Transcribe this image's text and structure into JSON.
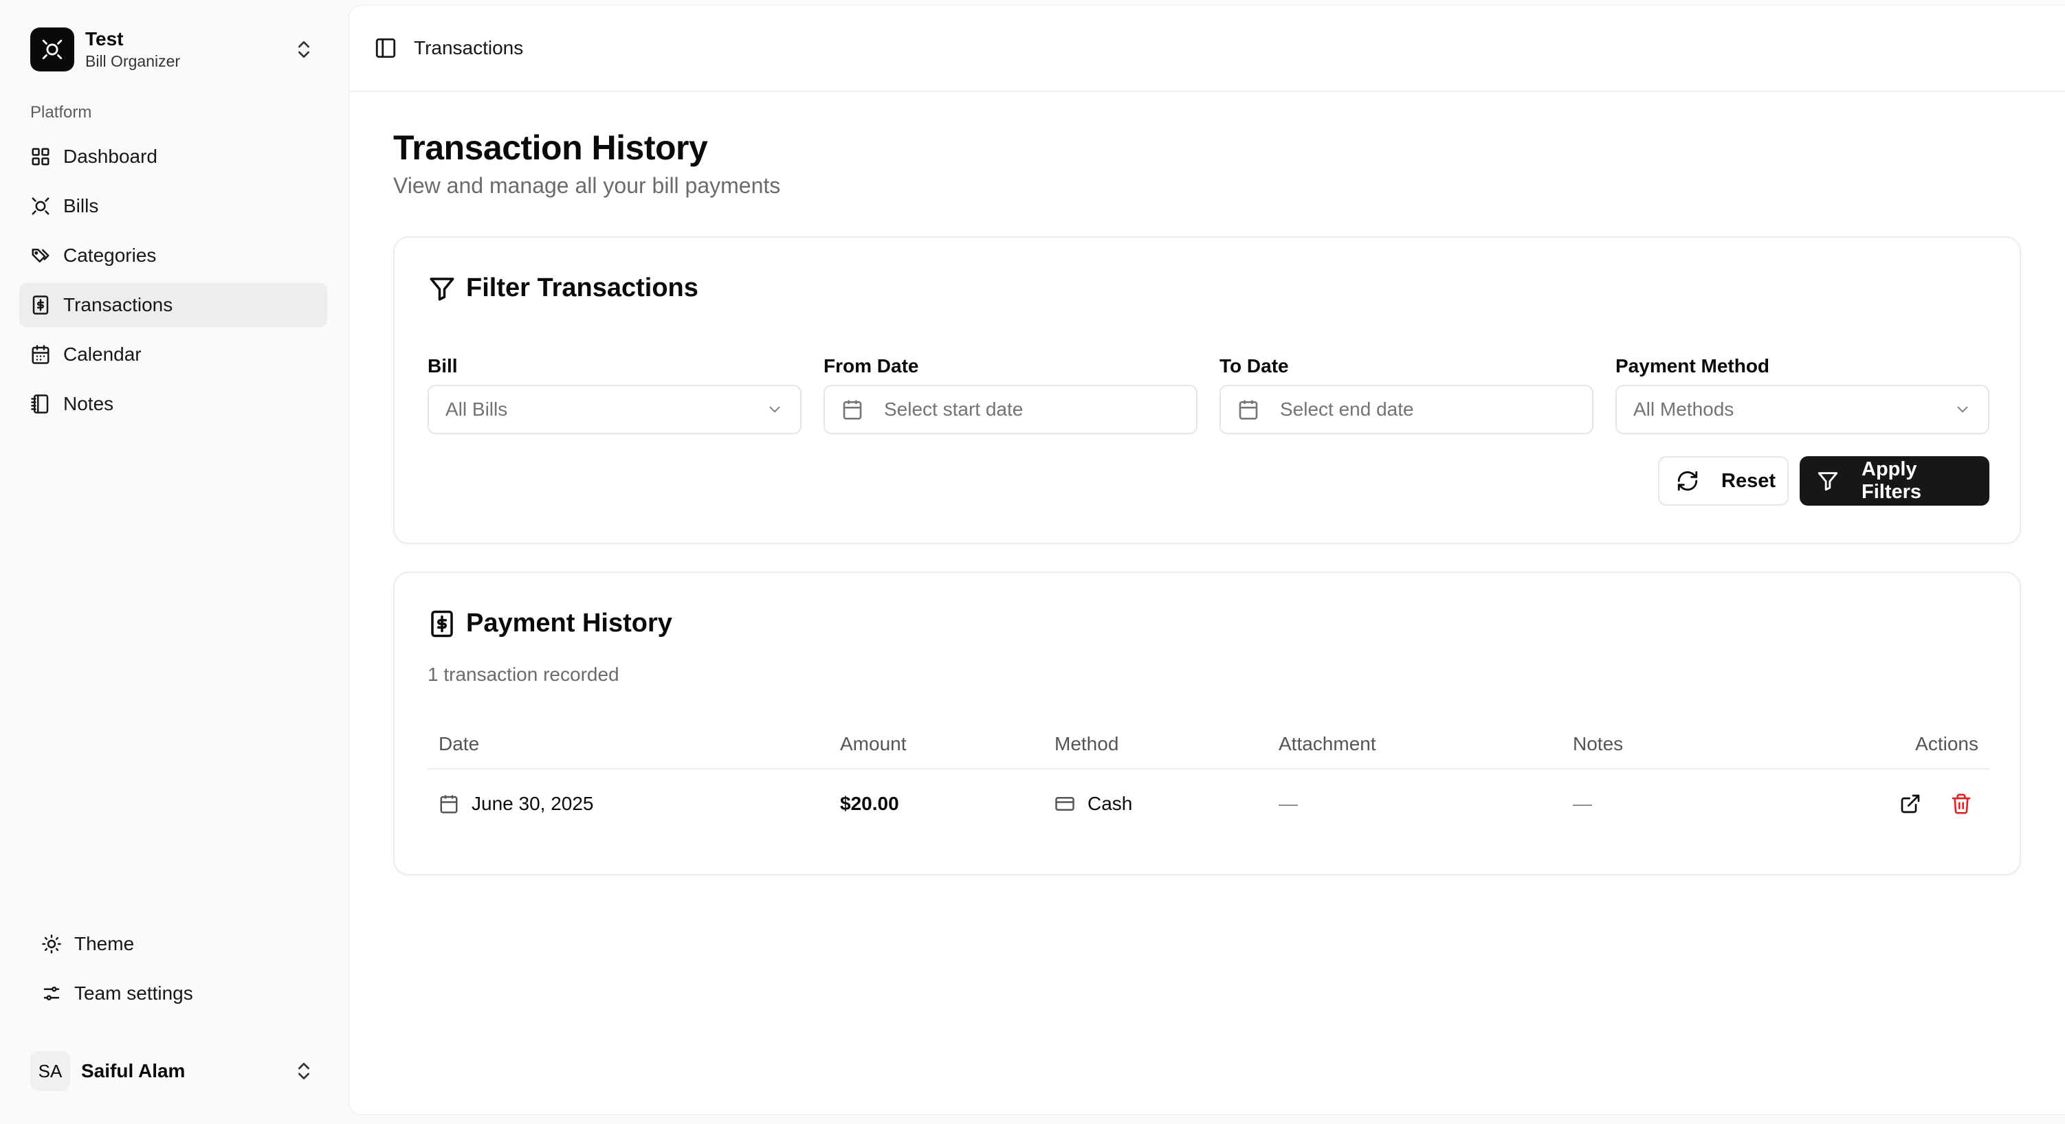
{
  "team": {
    "name": "Test",
    "subtitle": "Bill Organizer"
  },
  "sidebar": {
    "group_label": "Platform",
    "items": [
      {
        "label": "Dashboard",
        "icon": "grid-icon"
      },
      {
        "label": "Bills",
        "icon": "bill-icon"
      },
      {
        "label": "Categories",
        "icon": "tags-icon"
      },
      {
        "label": "Transactions",
        "icon": "receipt-icon",
        "active": true
      },
      {
        "label": "Calendar",
        "icon": "calendar-icon"
      },
      {
        "label": "Notes",
        "icon": "notebook-icon"
      }
    ],
    "footer_items": [
      {
        "label": "Theme",
        "icon": "sun-icon"
      },
      {
        "label": "Team settings",
        "icon": "sliders-icon"
      }
    ],
    "user": {
      "initials": "SA",
      "name": "Saiful Alam"
    }
  },
  "header": {
    "breadcrumb": "Transactions"
  },
  "page": {
    "title": "Transaction History",
    "subtitle": "View and manage all your bill payments"
  },
  "filters": {
    "title": "Filter Transactions",
    "bill": {
      "label": "Bill",
      "value": "All Bills"
    },
    "from_date": {
      "label": "From Date",
      "placeholder": "Select start date"
    },
    "to_date": {
      "label": "To Date",
      "placeholder": "Select end date"
    },
    "payment_method": {
      "label": "Payment Method",
      "value": "All Methods"
    },
    "reset_label": "Reset",
    "apply_label": "Apply Filters"
  },
  "history": {
    "title": "Payment History",
    "count_text": "1 transaction recorded",
    "columns": [
      "Date",
      "Amount",
      "Method",
      "Attachment",
      "Notes",
      "Actions"
    ],
    "rows": [
      {
        "date": "June 30, 2025",
        "amount": "$20.00",
        "method": "Cash",
        "attachment": "—",
        "notes": "—"
      }
    ]
  },
  "colors": {
    "primary": "#171717",
    "danger": "#dc2626",
    "sidebar_bg": "#fafafa",
    "active_item_bg": "#ededed"
  }
}
